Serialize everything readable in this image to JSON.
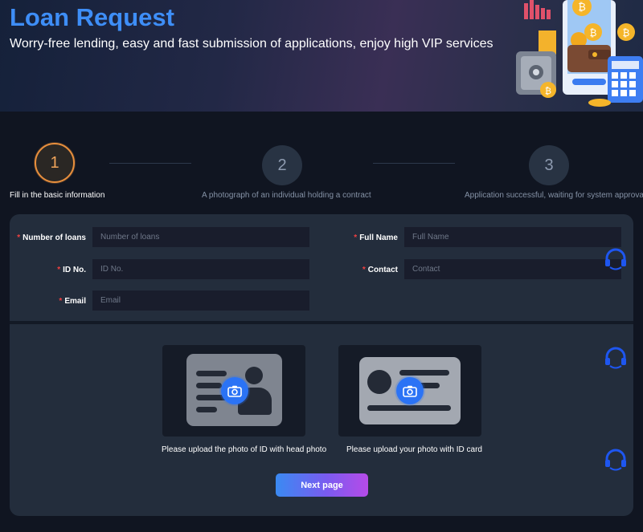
{
  "hero": {
    "title": "Loan Request",
    "subtitle": "Worry-free lending, easy and fast submission of applications, enjoy high VIP services"
  },
  "steps": [
    {
      "number": "1",
      "label": "Fill in the basic information",
      "active": true
    },
    {
      "number": "2",
      "label": "A photograph of an individual holding a contract",
      "active": false
    },
    {
      "number": "3",
      "label": "Application successful, waiting for system approval",
      "active": false
    }
  ],
  "form": {
    "required_mark": "*",
    "loans": {
      "label": "Number of loans",
      "placeholder": "Number of loans",
      "value": ""
    },
    "full_name": {
      "label": "Full Name",
      "placeholder": "Full Name",
      "value": ""
    },
    "id_no": {
      "label": "ID No.",
      "placeholder": "ID No.",
      "value": ""
    },
    "contact": {
      "label": "Contact",
      "placeholder": "Contact",
      "value": ""
    },
    "email": {
      "label": "Email",
      "placeholder": "Email",
      "value": ""
    }
  },
  "uploads": {
    "id_with_head": "Please upload the photo of ID with head photo",
    "photo_with_id": "Please upload your photo with ID card"
  },
  "next_button": "Next page",
  "icons": [
    "bitcoin-coin-icon",
    "safe-icon",
    "wallet-icon",
    "calculator-icon",
    "camera-icon",
    "headset-icon"
  ],
  "colors": {
    "accent_blue": "#3e8ef7",
    "step_active": "#e88f3d",
    "required": "#f04040",
    "camera": "#2b73f5",
    "support": "#1e56f0"
  }
}
